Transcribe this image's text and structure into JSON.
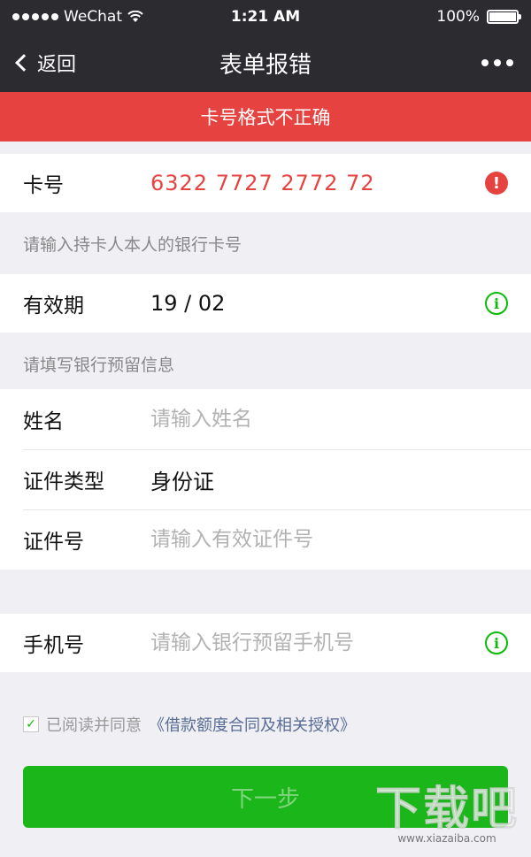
{
  "status_bar": {
    "carrier": "WeChat",
    "time": "1:21 AM",
    "battery_text": "100%"
  },
  "nav": {
    "back_label": "返回",
    "title": "表单报错"
  },
  "error_banner": "卡号格式不正确",
  "card": {
    "label": "卡号",
    "value": "6322 7727 2772 72"
  },
  "tip_card": "请输入持卡人本人的银行卡号",
  "expiry": {
    "label": "有效期",
    "value": "19 / 02"
  },
  "tip_bank": "请填写银行预留信息",
  "name": {
    "label": "姓名",
    "placeholder": "请输入姓名"
  },
  "id_type": {
    "label": "证件类型",
    "value": "身份证"
  },
  "id_number": {
    "label": "证件号",
    "placeholder": "请输入有效证件号"
  },
  "phone": {
    "label": "手机号",
    "placeholder": "请输入银行预留手机号"
  },
  "agreement": {
    "text": "已阅读并同意",
    "link": "《借款额度合同及相关授权》",
    "checked": true
  },
  "next_button": "下一步",
  "watermark": {
    "main": "下载吧",
    "sub": "www.xiazaiba.com"
  },
  "colors": {
    "nav_bg": "#2b2b30",
    "error": "#e64340",
    "primary_green": "#1bb71a",
    "info_green": "#09bb07",
    "link": "#586c94"
  },
  "icons": {
    "card_status": "error-icon",
    "expiry_status": "info-icon",
    "phone_status": "info-icon"
  }
}
